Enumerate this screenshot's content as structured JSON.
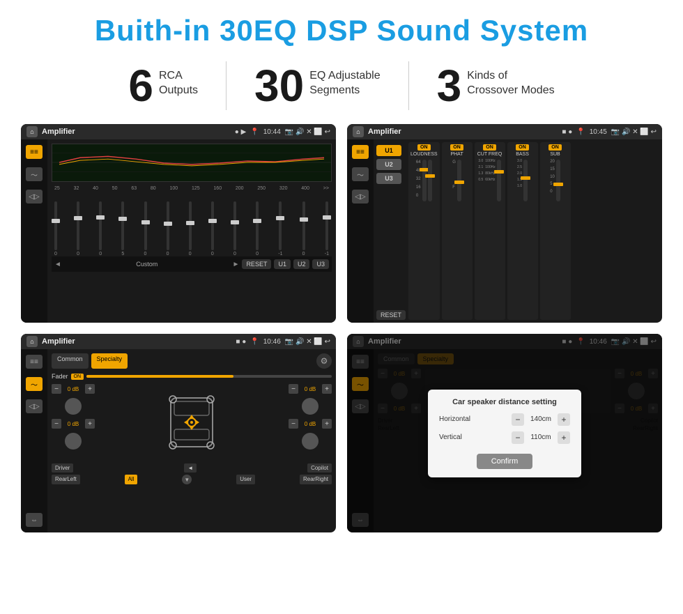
{
  "page": {
    "title": "Buith-in 30EQ DSP Sound System",
    "stats": [
      {
        "number": "6",
        "text": "RCA\nOutputs"
      },
      {
        "number": "30",
        "text": "EQ Adjustable\nSegments"
      },
      {
        "number": "3",
        "text": "Kinds of\nCrossover Modes"
      }
    ]
  },
  "screen1": {
    "time": "10:44",
    "title": "Amplifier",
    "freqs": [
      "25",
      "32",
      "40",
      "50",
      "63",
      "80",
      "100",
      "125",
      "160",
      "200",
      "250",
      "320",
      "400"
    ],
    "values": [
      "0",
      "0",
      "0",
      "5",
      "0",
      "0",
      "0",
      "0",
      "0",
      "0",
      "-1",
      "0",
      "-1"
    ],
    "preset": "Custom",
    "buttons": [
      "RESET",
      "U1",
      "U2",
      "U3"
    ]
  },
  "screen2": {
    "time": "10:45",
    "title": "Amplifier",
    "uButtons": [
      "U1",
      "U2",
      "U3"
    ],
    "sections": [
      {
        "label": "LOUDNESS",
        "on": true
      },
      {
        "label": "PHAT",
        "on": true
      },
      {
        "label": "CUT FREQ",
        "on": true
      },
      {
        "label": "BASS",
        "on": true
      },
      {
        "label": "SUB",
        "on": true
      }
    ],
    "resetBtn": "RESET"
  },
  "screen3": {
    "time": "10:46",
    "title": "Amplifier",
    "tabs": [
      "Common",
      "Specialty"
    ],
    "activeTab": "Specialty",
    "fader": "Fader",
    "faderOn": "ON",
    "dbValues": [
      "0 dB",
      "0 dB",
      "0 dB",
      "0 dB"
    ],
    "labels": [
      "Driver",
      "Copilot",
      "RearLeft",
      "All",
      "User",
      "RearRight"
    ]
  },
  "screen4": {
    "time": "10:46",
    "title": "Amplifier",
    "tabs": [
      "Common",
      "Specialty"
    ],
    "dialog": {
      "title": "Car speaker distance setting",
      "horizontal": "140cm",
      "vertical": "110cm",
      "confirmBtn": "Confirm"
    },
    "labels": [
      "Driver",
      "Copilot",
      "RearLeft",
      "All",
      "User",
      "RearRight"
    ]
  }
}
